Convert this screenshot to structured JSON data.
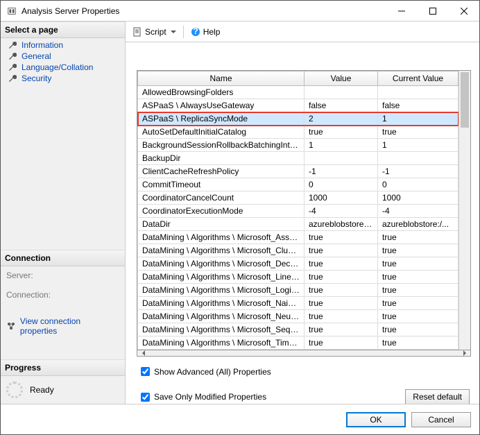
{
  "window": {
    "title": "Analysis Server Properties"
  },
  "left": {
    "select_page": "Select a page",
    "pages": [
      "Information",
      "General",
      "Language/Collation",
      "Security"
    ],
    "connection": {
      "title": "Connection",
      "server_label": "Server:",
      "connection_label": "Connection:",
      "view_props": "View connection properties"
    },
    "progress": {
      "title": "Progress",
      "status": "Ready"
    }
  },
  "toolbar": {
    "script": "Script",
    "help": "Help"
  },
  "grid": {
    "headers": {
      "name": "Name",
      "value": "Value",
      "current": "Current Value"
    },
    "rows": [
      {
        "name": "AllowedBrowsingFolders",
        "value": "",
        "current": ""
      },
      {
        "name": "ASPaaS \\ AlwaysUseGateway",
        "value": "false",
        "current": "false"
      },
      {
        "name": "ASPaaS \\ ReplicaSyncMode",
        "value": "2",
        "current": "1",
        "selected": true,
        "highlight": true
      },
      {
        "name": "AutoSetDefaultInitialCatalog",
        "value": "true",
        "current": "true"
      },
      {
        "name": "BackgroundSessionRollbackBatchingInterval",
        "value": "1",
        "current": "1"
      },
      {
        "name": "BackupDir",
        "value": "",
        "current": ""
      },
      {
        "name": "ClientCacheRefreshPolicy",
        "value": "-1",
        "current": "-1"
      },
      {
        "name": "CommitTimeout",
        "value": "0",
        "current": "0"
      },
      {
        "name": "CoordinatorCancelCount",
        "value": "1000",
        "current": "1000"
      },
      {
        "name": "CoordinatorExecutionMode",
        "value": "-4",
        "current": "-4"
      },
      {
        "name": "DataDir",
        "value": "azureblobstore:/...",
        "current": "azureblobstore:/..."
      },
      {
        "name": "DataMining \\ Algorithms \\ Microsoft_Associati...",
        "value": "true",
        "current": "true"
      },
      {
        "name": "DataMining \\ Algorithms \\ Microsoft_Clusterin...",
        "value": "true",
        "current": "true"
      },
      {
        "name": "DataMining \\ Algorithms \\ Microsoft_Decision...",
        "value": "true",
        "current": "true"
      },
      {
        "name": "DataMining \\ Algorithms \\ Microsoft_Linear_R...",
        "value": "true",
        "current": "true"
      },
      {
        "name": "DataMining \\ Algorithms \\ Microsoft_Logistic_...",
        "value": "true",
        "current": "true"
      },
      {
        "name": "DataMining \\ Algorithms \\ Microsoft_Naive_B...",
        "value": "true",
        "current": "true"
      },
      {
        "name": "DataMining \\ Algorithms \\ Microsoft_Neural_...",
        "value": "true",
        "current": "true"
      },
      {
        "name": "DataMining \\ Algorithms \\ Microsoft_Sequenc...",
        "value": "true",
        "current": "true"
      },
      {
        "name": "DataMining \\ Algorithms \\ Microsoft_Time_Se...",
        "value": "true",
        "current": "true"
      }
    ]
  },
  "opts": {
    "show_advanced": "Show Advanced (All) Properties",
    "save_modified": "Save Only Modified Properties",
    "reset": "Reset default"
  },
  "dlg": {
    "ok": "OK",
    "cancel": "Cancel"
  }
}
